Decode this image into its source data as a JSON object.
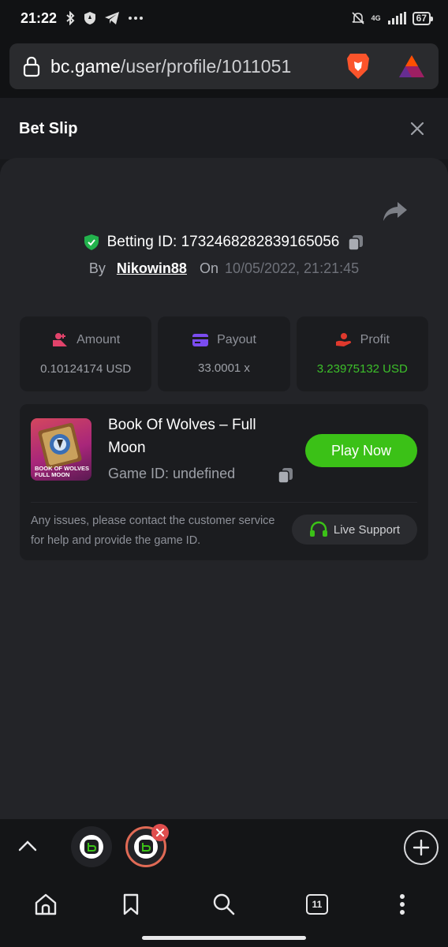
{
  "status_bar": {
    "time": "21:22",
    "network": "4G",
    "battery": "67",
    "icons": [
      "bluetooth-icon",
      "shield-icon",
      "telegram-icon",
      "more-dots-icon",
      "bell-off-icon",
      "signal-icon"
    ]
  },
  "browser": {
    "url_domain": "bc.game",
    "url_path": "/user/profile/1011051",
    "icons": [
      "lock-icon",
      "brave-lion-icon",
      "bat-triangle-icon"
    ]
  },
  "bet_slip": {
    "title": "Bet Slip",
    "betting_id_label": "Betting ID: 1732468282839165056",
    "by_label": "By",
    "username": "Nikowin88",
    "on_label": "On",
    "date": "10/05/2022, 21:21:45"
  },
  "stats": [
    {
      "label": "Amount",
      "value": "0.10124174 USD",
      "icon": "amount-icon",
      "color": "#e2436b"
    },
    {
      "label": "Payout",
      "value": "33.0001 x",
      "icon": "payout-card-icon",
      "color": "#7b4cf0"
    },
    {
      "label": "Profit",
      "value": "3.23975132 USD",
      "icon": "profit-hand-icon",
      "color": "#e0392d"
    }
  ],
  "game": {
    "title": "Book Of Wolves – Full Moon",
    "id_label": "Game ID: undefined",
    "thumb_text_1": "BOOK OF WOLVES",
    "thumb_text_2": "FULL MOON",
    "play_label": "Play Now",
    "issues_text": "Any issues, please contact the customer service for help and provide the game ID.",
    "support_label": "Live Support"
  },
  "tabs": {
    "open_count": "11"
  },
  "colors": {
    "accent_green": "#3bc117",
    "profit_green": "#3dc02a",
    "verified_green": "#22b24c",
    "panel_bg": "#232428",
    "card_bg": "#1b1c1f"
  }
}
